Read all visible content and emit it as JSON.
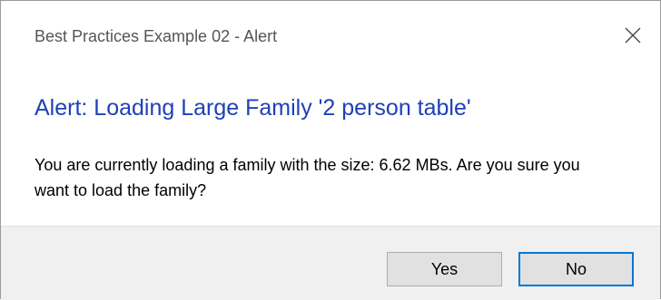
{
  "window": {
    "title": "Best Practices Example 02 - Alert"
  },
  "dialog": {
    "main_instruction": "Alert: Loading Large Family '2 person table'",
    "message": "You are currently loading a family with the size: 6.62 MBs. Are you sure you want to load the family?"
  },
  "buttons": {
    "yes_label": "Yes",
    "no_label": "No"
  },
  "icons": {
    "close": "close-icon"
  },
  "colors": {
    "instruction_text": "#1f40b7",
    "footer_background": "#f0f0f0",
    "button_background": "#e1e1e1",
    "focused_button_border": "#0078d7"
  }
}
